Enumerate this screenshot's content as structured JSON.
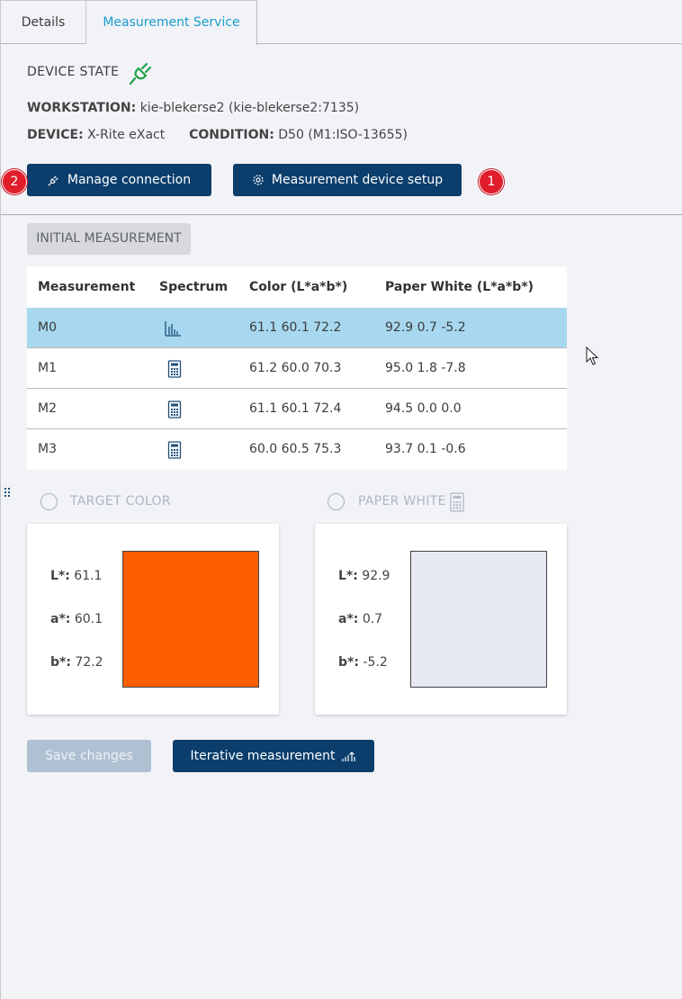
{
  "tabs": [
    {
      "label": "Details",
      "active": false
    },
    {
      "label": "Measurement Service",
      "active": true
    }
  ],
  "device_state": {
    "label": "DEVICE STATE",
    "icon": "plug-connected-icon",
    "status_color": "#1ea24a"
  },
  "workstation": {
    "label": "WORKSTATION:",
    "value": "kie-blekerse2 (kie-blekerse2:7135)"
  },
  "device": {
    "label": "DEVICE:",
    "value": "X-Rite eXact"
  },
  "condition": {
    "label": "CONDITION:",
    "value": "D50 (M1:ISO-13655)"
  },
  "buttons": {
    "manage_connection": "Manage connection",
    "measurement_device_setup": "Measurement device setup",
    "initial_measurement": "INITIAL MEASUREMENT",
    "save_changes": "Save changes",
    "iterative_measurement": "Iterative measurement"
  },
  "badges": {
    "manage": "2",
    "setup": "1"
  },
  "table": {
    "headers": [
      "Measurement",
      "Spectrum",
      "Color (L*a*b*)",
      "Paper White (L*a*b*)"
    ],
    "rows": [
      {
        "name": "M0",
        "spectrum_icon": "bar-chart-icon",
        "color": "61.1 60.1 72.2",
        "paper_white": "92.9 0.7 -5.2",
        "selected": true
      },
      {
        "name": "M1",
        "spectrum_icon": "calculator-icon",
        "color": "61.2 60.0 70.3",
        "paper_white": "95.0 1.8 -7.8",
        "selected": false
      },
      {
        "name": "M2",
        "spectrum_icon": "calculator-icon",
        "color": "61.1 60.1 72.4",
        "paper_white": "94.5 0.0 0.0",
        "selected": false
      },
      {
        "name": "M3",
        "spectrum_icon": "calculator-icon",
        "color": "60.0 60.5 75.3",
        "paper_white": "93.7 0.1 -0.6",
        "selected": false
      }
    ]
  },
  "target_color": {
    "label": "TARGET COLOR",
    "L_label": "L*:",
    "L": "61.1",
    "a_label": "a*:",
    "a": "60.1",
    "b_label": "b*:",
    "b": "72.2",
    "swatch_color": "#fd5e00"
  },
  "paper_white": {
    "label": "PAPER WHITE",
    "icon": "calculator-icon",
    "L_label": "L*:",
    "L": "92.9",
    "a_label": "a*:",
    "a": "0.7",
    "b_label": "b*:",
    "b": "-5.2",
    "swatch_color": "#e7e9f2"
  },
  "colors": {
    "primary": "#0b3e6c",
    "active_tab": "#1a9ccc",
    "badge": "#e01e2b",
    "selected_row": "#a7d8ef",
    "disabled_button": "#aec0d2"
  }
}
